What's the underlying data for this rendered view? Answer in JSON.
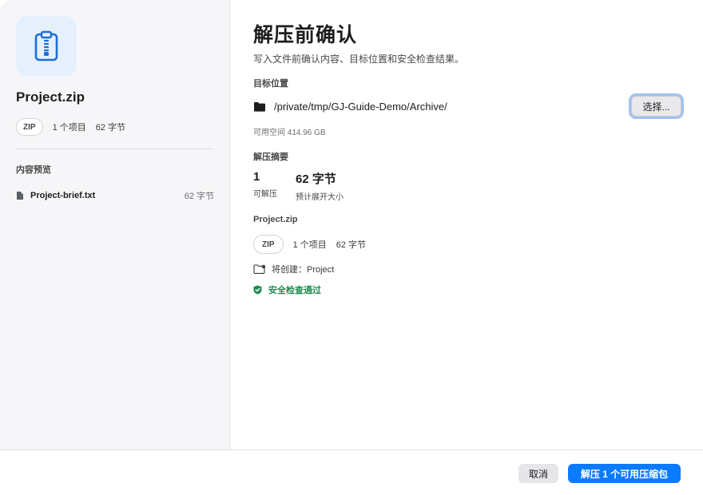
{
  "sidebar": {
    "archive_name": "Project.zip",
    "format_badge": "ZIP",
    "item_count": "1 个项目",
    "size": "62 字节",
    "preview_title": "内容预览",
    "files": [
      {
        "name": "Project-brief.txt",
        "size": "62 字节",
        "icon": "document-icon"
      }
    ],
    "archive_icon": "zip-archive-icon"
  },
  "main": {
    "title": "解压前确认",
    "subtitle": "写入文件前确认内容、目标位置和安全检查结果。",
    "destination_label": "目标位置",
    "destination_path": "/private/tmp/GJ-Guide-Demo/Archive/",
    "destination_icon": "folder-icon",
    "choose_button": "选择...",
    "free_space": "可用空间 414.96 GB",
    "summary_label": "解压摘要",
    "stats": [
      {
        "value": "1",
        "label": "可解压"
      },
      {
        "value": "62 字节",
        "label": "预计展开大小"
      }
    ],
    "archive": {
      "name": "Project.zip",
      "format_badge": "ZIP",
      "item_count": "1 个项目",
      "size": "62 字节",
      "will_create": "将创建：Project",
      "safety_status": "安全检查通过"
    }
  },
  "footer": {
    "cancel_button": "取消",
    "extract_button": "解压 1 个可用压缩包"
  },
  "colors": {
    "accent": "#0a7aff",
    "success": "#1f8a4c",
    "sidebar_bg": "#f6f6f8",
    "icon_tile_bg": "#e6f0fc"
  }
}
